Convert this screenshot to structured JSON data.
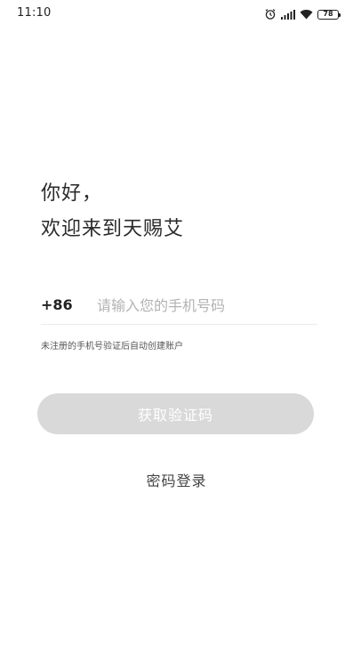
{
  "status_bar": {
    "time": "11:10",
    "battery": "78",
    "icons": [
      "alarm-icon",
      "signal-icon",
      "wifi-icon",
      "battery-icon"
    ]
  },
  "greeting": {
    "line1": "你好，",
    "line2": "欢迎来到天赐艾"
  },
  "phone": {
    "country_code": "+86",
    "placeholder": "请输入您的手机号码",
    "value": ""
  },
  "hint": "未注册的手机号验证后自动创建账户",
  "get_code_button": {
    "label": "获取验证码",
    "enabled": false
  },
  "password_login": "密码登录",
  "colors": {
    "button_disabled": "#d9d9d9",
    "placeholder": "#b3b3b3",
    "text": "#2a2a2a"
  }
}
